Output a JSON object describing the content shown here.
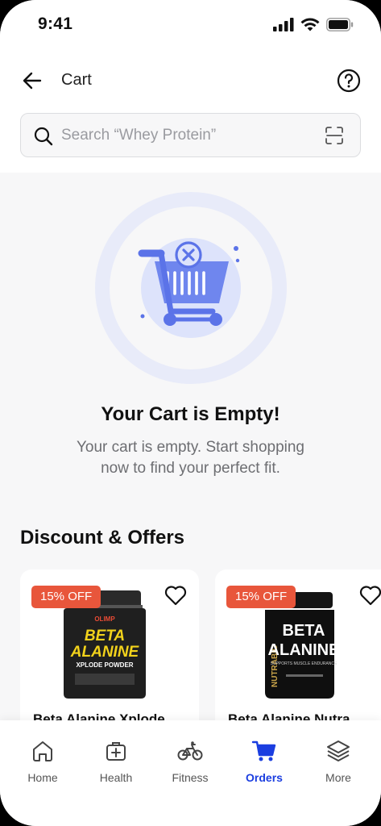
{
  "status_bar": {
    "time": "9:41"
  },
  "header": {
    "title": "Cart"
  },
  "search": {
    "placeholder": "Search “Whey Protein”"
  },
  "empty_state": {
    "title": "Your Cart is Empty!",
    "subtitle_line1": "Your cart is empty. Start shopping",
    "subtitle_line2": "now to find your perfect fit."
  },
  "offers": {
    "section_title": "Discount & Offers",
    "products": [
      {
        "badge": "15% OFF",
        "name": "Beta Alanine Xplode",
        "brand": "OLIMP",
        "label_line1": "BETA",
        "label_line2": "ALANINE",
        "label_line3": "XPLODE POWDER"
      },
      {
        "badge": "15% OFF",
        "name": "Beta Alanine Nutra",
        "brand": "NUTRABIO",
        "label_line1": "BETA",
        "label_line2": "ALANINE",
        "label_line3": "SUPPORTS MUSCLE ENDURANCE"
      }
    ]
  },
  "bottom_nav": {
    "items": [
      {
        "label": "Home",
        "icon": "home-icon"
      },
      {
        "label": "Health",
        "icon": "medical-kit-icon"
      },
      {
        "label": "Fitness",
        "icon": "bicycle-icon"
      },
      {
        "label": "Orders",
        "icon": "cart-icon",
        "active": true
      },
      {
        "label": "More",
        "icon": "layers-icon"
      }
    ]
  },
  "colors": {
    "accent": "#1b3ee0",
    "badge": "#e8563b",
    "illustration": "#5b73e8"
  }
}
